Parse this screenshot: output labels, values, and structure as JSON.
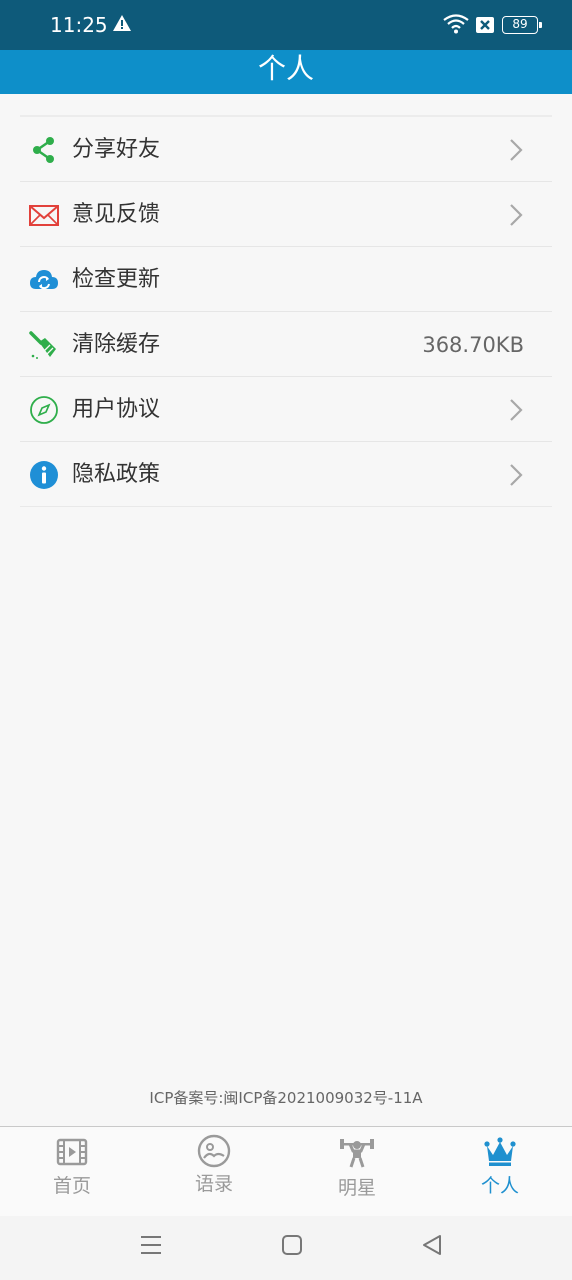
{
  "status_bar": {
    "time": "11:25",
    "battery": "89"
  },
  "header": {
    "title": "个人"
  },
  "menu": {
    "items": [
      {
        "label": "分享好友",
        "icon": "share-icon",
        "icon_color": "#2fae4b",
        "has_arrow": true
      },
      {
        "label": "意见反馈",
        "icon": "mail-icon",
        "icon_color": "#e2413b",
        "has_arrow": true
      },
      {
        "label": "检查更新",
        "icon": "cloud-refresh-icon",
        "icon_color": "#1f8fd6",
        "has_arrow": false
      },
      {
        "label": "清除缓存",
        "icon": "broom-icon",
        "icon_color": "#2fae4b",
        "value": "368.70KB",
        "has_arrow": false
      },
      {
        "label": "用户协议",
        "icon": "compass-icon",
        "icon_color": "#2fae4b",
        "has_arrow": true
      },
      {
        "label": "隐私政策",
        "icon": "info-icon",
        "icon_color": "#1f8fd6",
        "has_arrow": true
      }
    ]
  },
  "footer": {
    "icp": "ICP备案号:闽ICP备2021009032号-11A"
  },
  "tabbar": {
    "tabs": [
      {
        "label": "首页",
        "icon": "film-icon",
        "active": false
      },
      {
        "label": "语录",
        "icon": "picture-icon",
        "active": false
      },
      {
        "label": "明星",
        "icon": "weightlifter-icon",
        "active": false
      },
      {
        "label": "个人",
        "icon": "crown-icon",
        "active": true
      }
    ],
    "active_color": "#1f90cf",
    "inactive_color": "#9a9a9a"
  },
  "colors": {
    "status_bar": "#0e5a7a",
    "header": "#0e8fc9",
    "background": "#f7f7f7"
  }
}
